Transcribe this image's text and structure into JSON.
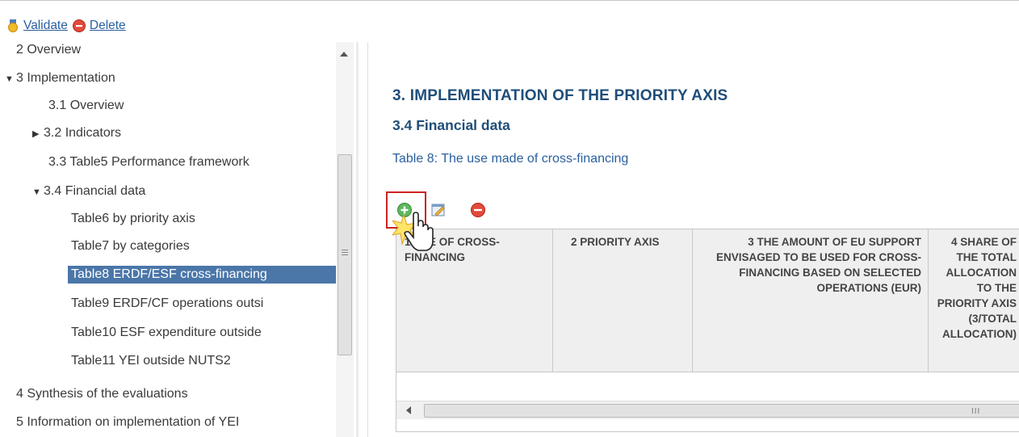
{
  "toolbar": {
    "validate_label": "Validate",
    "delete_label": "Delete"
  },
  "tree": {
    "items": [
      {
        "label": "2 Overview"
      },
      {
        "label": "3 Implementation"
      },
      {
        "label": "3.1 Overview"
      },
      {
        "label": "3.2 Indicators"
      },
      {
        "label": "3.3 Table5 Performance framework"
      },
      {
        "label": "3.4 Financial data"
      },
      {
        "label": "Table6 by priority axis"
      },
      {
        "label": "Table7 by categories"
      },
      {
        "label": "Table8 ERDF/ESF cross-financing"
      },
      {
        "label": "Table9 ERDF/CF operations outsi"
      },
      {
        "label": "Table10 ESF expenditure outside"
      },
      {
        "label": "Table11 YEI outside NUTS2"
      },
      {
        "label": "4 Synthesis of the evaluations"
      },
      {
        "label": "5 Information on implementation of YEI"
      }
    ]
  },
  "main": {
    "heading": "3. IMPLEMENTATION OF THE PRIORITY AXIS",
    "subheading": "3.4 Financial data",
    "table_caption": "Table 8: The use made of cross-financing"
  },
  "grid": {
    "columns": [
      {
        "label": "1 USE OF CROSS-FINANCING"
      },
      {
        "label": "2 PRIORITY AXIS"
      },
      {
        "label": "3 THE AMOUNT OF EU SUPPORT ENVISAGED TO BE USED FOR CROSS-FINANCING BASED ON SELECTED OPERATIONS (EUR)"
      },
      {
        "label": "4 SHARE OF THE TOTAL ALLOCATION TO THE PRIORITY AXIS (3/TOTAL ALLOCATION)"
      }
    ]
  },
  "colors": {
    "heading": "#1f4e79",
    "link": "#2a5f9e",
    "selection": "#4a76a8",
    "highlight_box": "#cc2222"
  }
}
